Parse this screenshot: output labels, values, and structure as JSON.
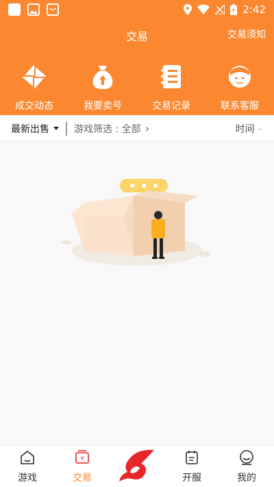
{
  "status": {
    "time": "2:42"
  },
  "header": {
    "title": "交易",
    "notice_label": "交易须知"
  },
  "quick_actions": [
    {
      "label": "成交动态",
      "icon": "pinwheel-icon"
    },
    {
      "label": "我要卖号",
      "icon": "moneybag-icon"
    },
    {
      "label": "交易记录",
      "icon": "notebook-icon"
    },
    {
      "label": "联系客服",
      "icon": "headset-icon"
    }
  ],
  "filter": {
    "sort_label": "最新出售",
    "game_filter_label": "游戏筛选 : 全部",
    "time_label": "时间"
  },
  "tabs": [
    {
      "label": "游戏",
      "icon": "home-icon",
      "active": false
    },
    {
      "label": "交易",
      "icon": "trade-icon",
      "active": true
    },
    {
      "label": "",
      "icon": "app-logo-icon",
      "active": false
    },
    {
      "label": "开服",
      "icon": "calendar-icon",
      "active": false
    },
    {
      "label": "我的",
      "icon": "profile-icon",
      "active": false
    }
  ],
  "colors": {
    "accent": "#fb8831",
    "background": "#f8f8f8"
  }
}
